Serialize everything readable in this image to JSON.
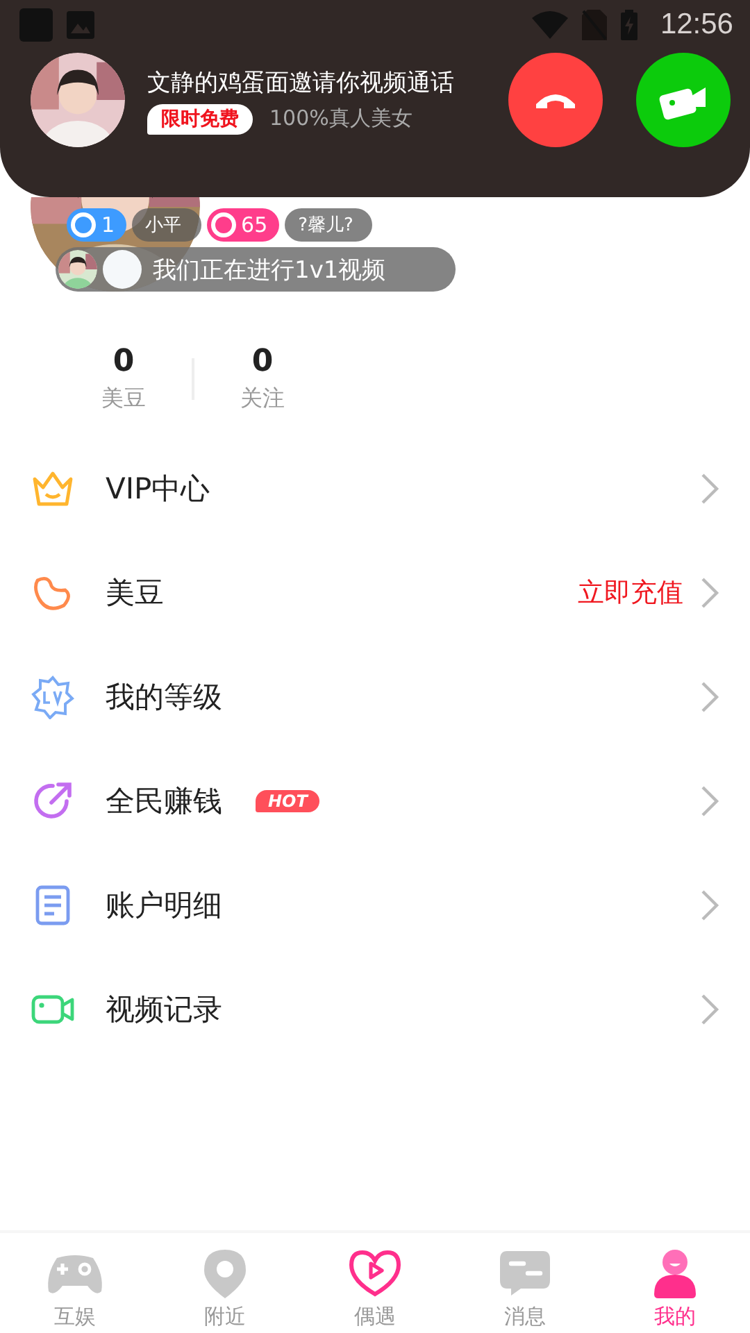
{
  "status_bar": {
    "time": "12:56"
  },
  "call_notification": {
    "title": "文静的鸡蛋面邀请你视频通话",
    "badge": "限时免费",
    "subtitle": "100%真人美女"
  },
  "profile": {
    "badges": [
      {
        "kind": "level",
        "text": "1",
        "color": "#3d9bff"
      },
      {
        "kind": "name",
        "text": "小平"
      },
      {
        "kind": "level",
        "text": "65",
        "color": "#ff3d8b"
      },
      {
        "kind": "name",
        "text": "?馨儿?"
      }
    ],
    "status_message": "我们正在进行1v1视频"
  },
  "stats": [
    {
      "value": "0",
      "label": "美豆"
    },
    {
      "value": "0",
      "label": "关注"
    }
  ],
  "menu": [
    {
      "kind": "vip",
      "label": "VIP中心"
    },
    {
      "kind": "beans",
      "label": "美豆",
      "action": "立即充值"
    },
    {
      "kind": "level",
      "label": "我的等级"
    },
    {
      "kind": "earn",
      "label": "全民赚钱",
      "tag": "HOT"
    },
    {
      "kind": "account",
      "label": "账户明细"
    },
    {
      "kind": "video",
      "label": "视频记录"
    }
  ],
  "tabs": [
    {
      "kind": "game",
      "label": "互娱",
      "selected": false
    },
    {
      "kind": "nearby",
      "label": "附近",
      "selected": false
    },
    {
      "kind": "meet",
      "label": "偶遇",
      "selected": false
    },
    {
      "kind": "message",
      "label": "消息",
      "selected": false
    },
    {
      "kind": "me",
      "label": "我的",
      "selected": true
    }
  ]
}
